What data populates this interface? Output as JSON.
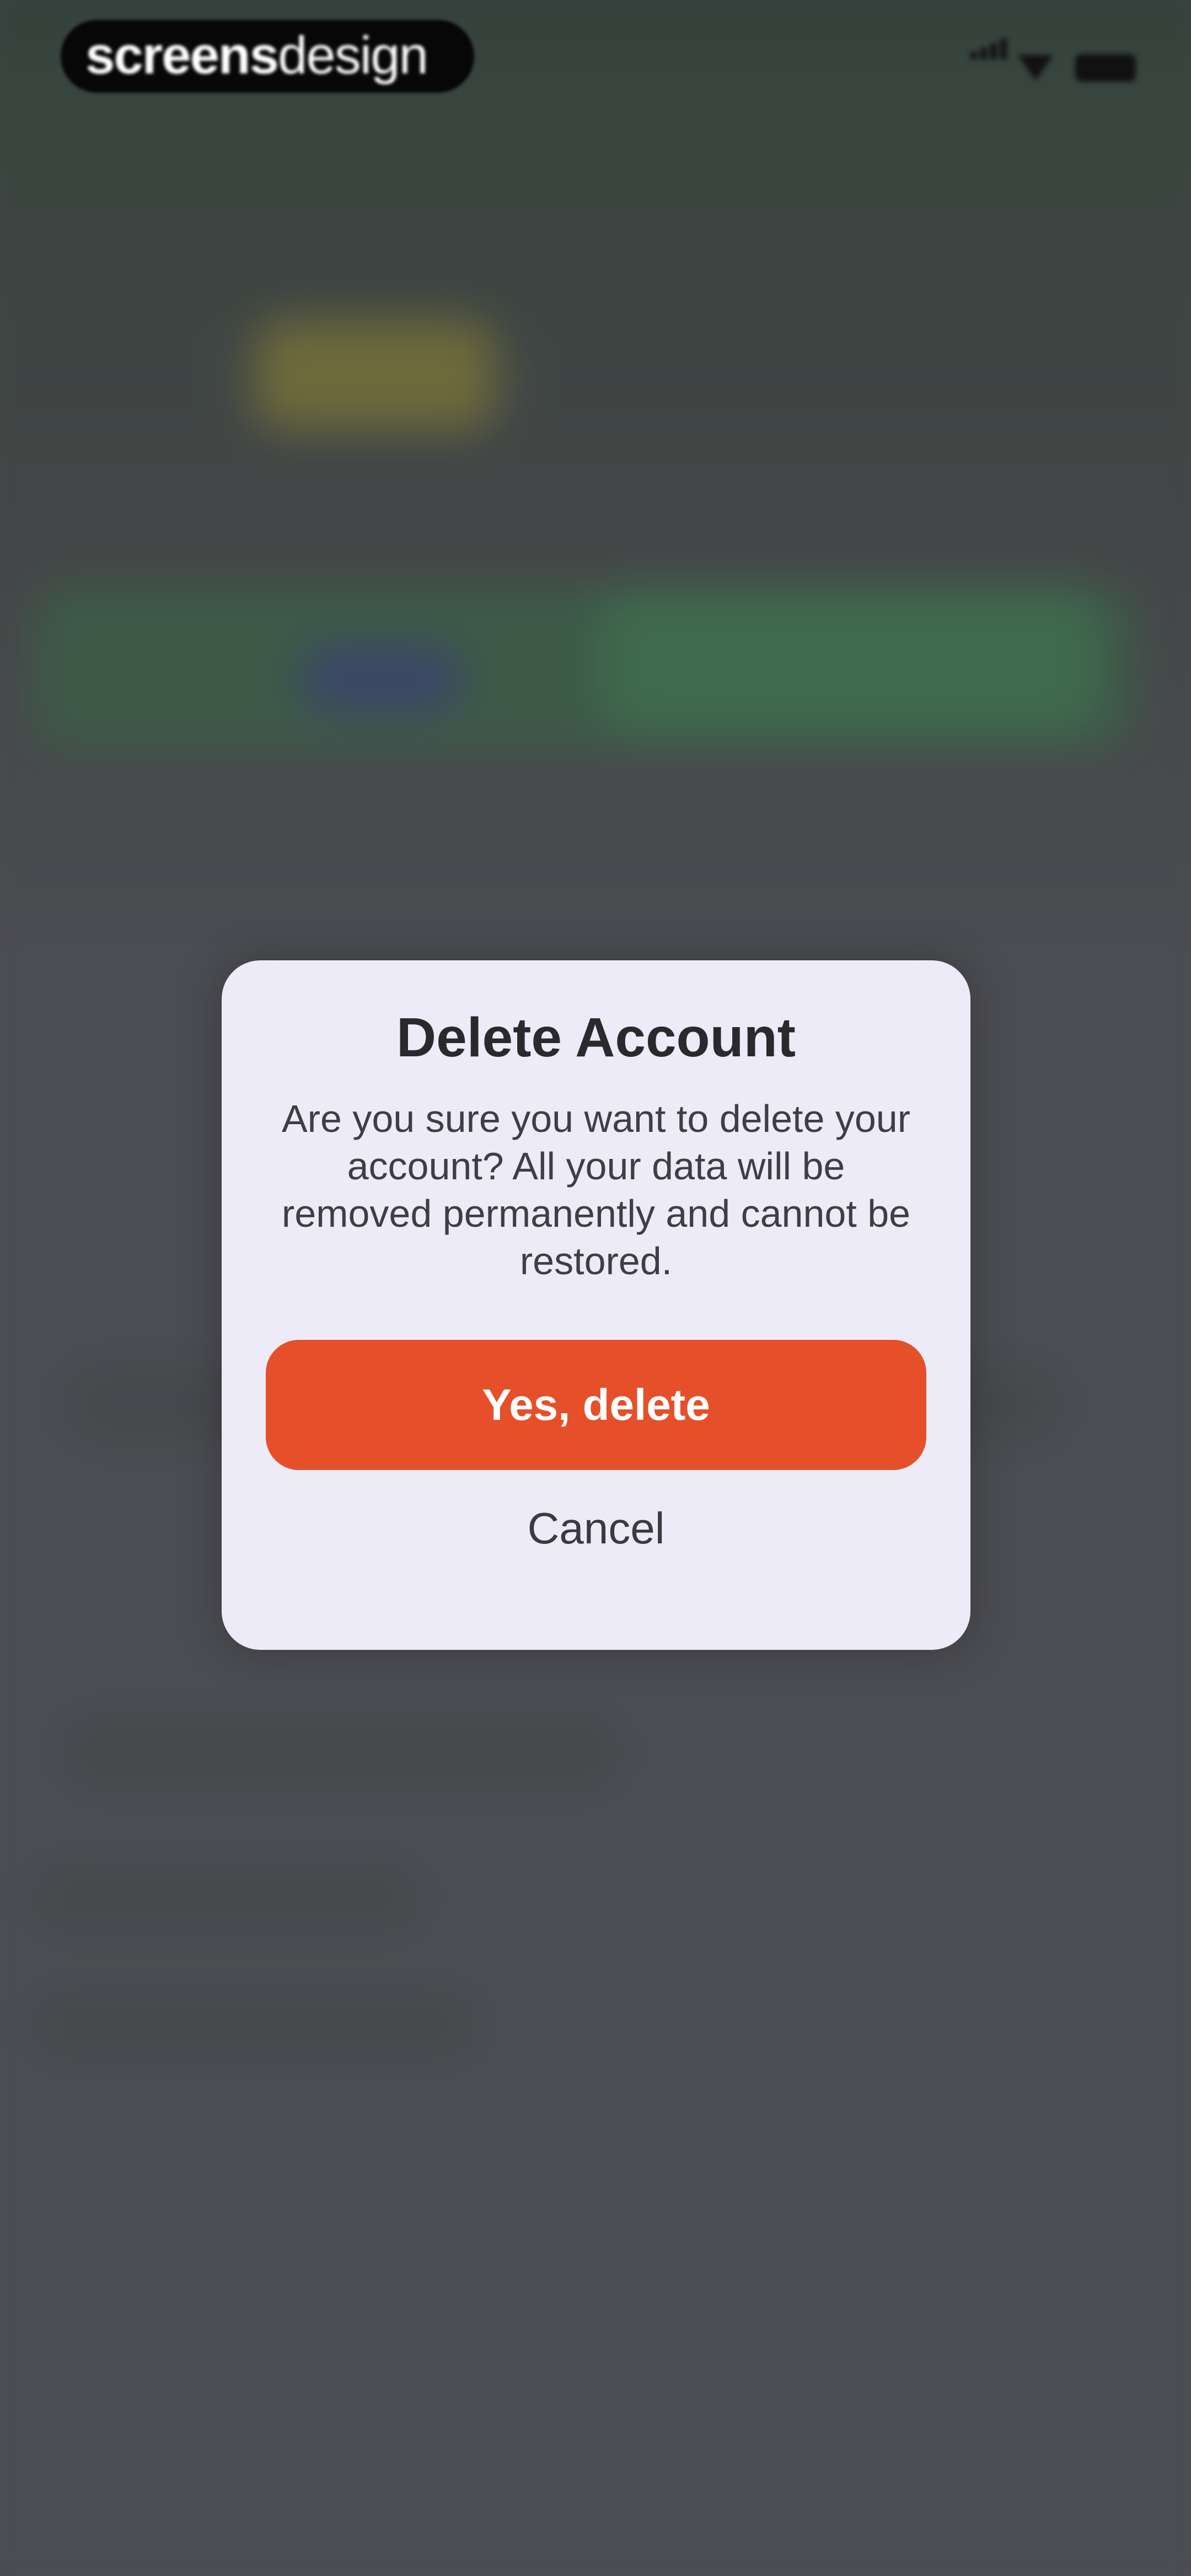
{
  "watermark": {
    "brand_bold": "screens",
    "brand_light": "design"
  },
  "status_bar": {
    "signal_icon": "signal-icon",
    "wifi_icon": "wifi-icon",
    "battery_icon": "battery-icon"
  },
  "dialog": {
    "title": "Delete Account",
    "message": "Are you sure you want to delete your account? All your data will be removed permanently and cannot be restored.",
    "confirm_label": "Yes, delete",
    "cancel_label": "Cancel"
  },
  "colors": {
    "accent": "#e5502a",
    "dialog_background": "#edebf7",
    "overlay": "#4c4d52"
  }
}
